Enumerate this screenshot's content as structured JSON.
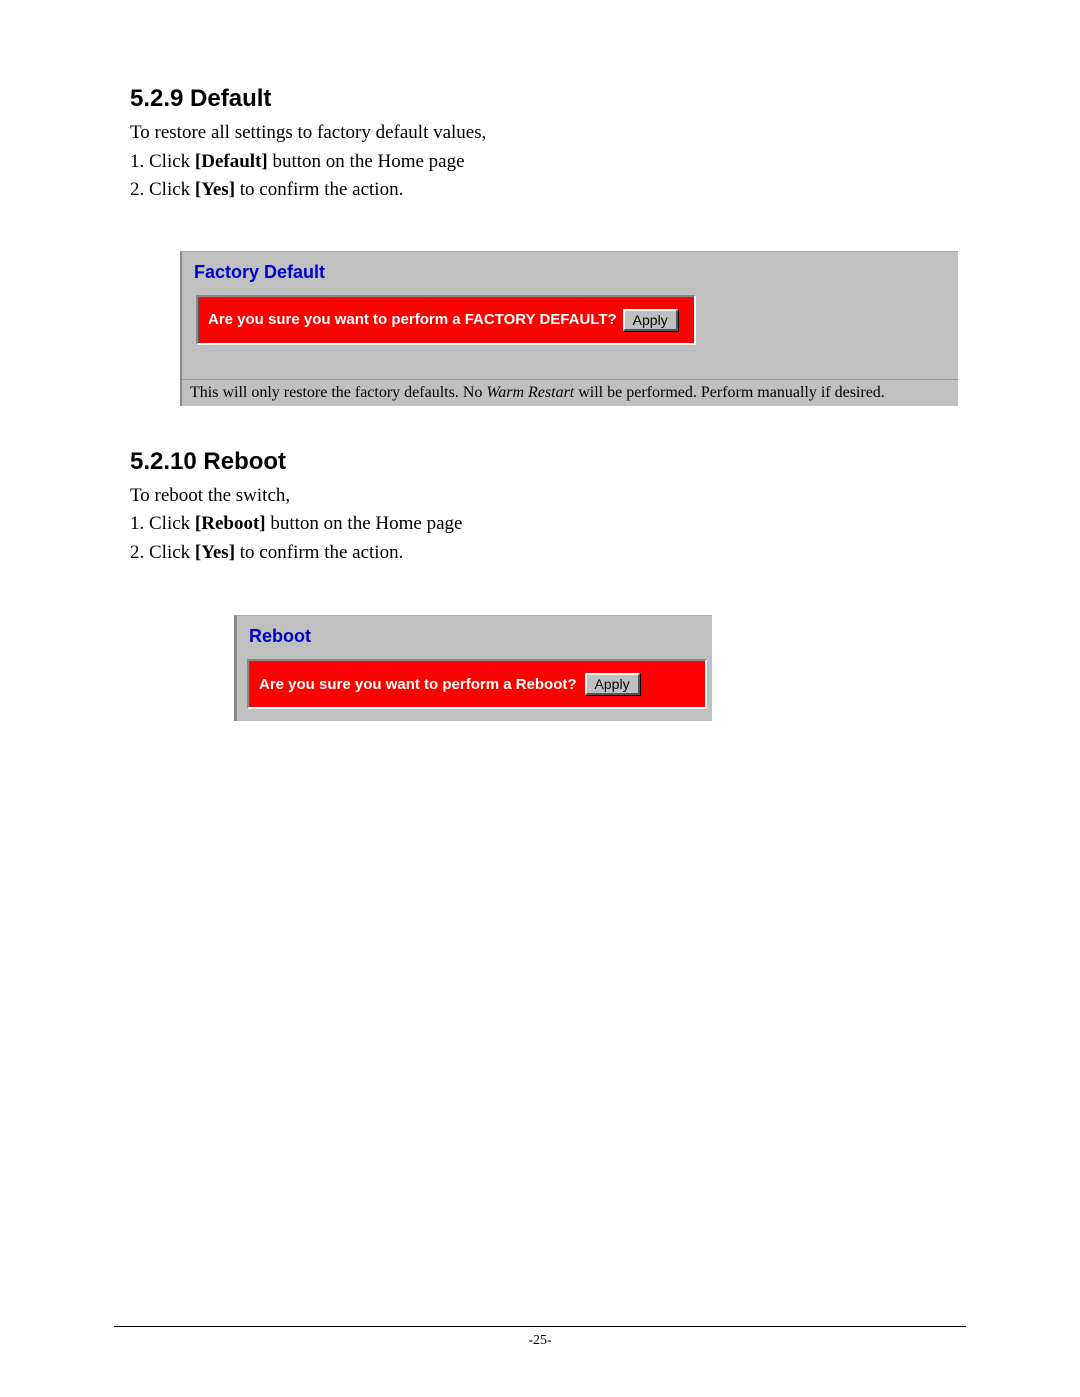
{
  "section1": {
    "heading": "5.2.9  Default",
    "intro": "To restore all settings to factory default values,",
    "step1_num": "1.  ",
    "step1_a": "Click ",
    "step1_bold": "[Default]",
    "step1_b": " button on the Home page",
    "step2_num": "2.  ",
    "step2_a": "Click ",
    "step2_bold": "[Yes]",
    "step2_b": " to confirm the action."
  },
  "panel1": {
    "title": "Factory Default",
    "question": "Are you sure you want to perform a FACTORY DEFAULT?",
    "button": "Apply",
    "note_a": "This will only restore the factory defaults.  No ",
    "note_italic": "Warm Restart",
    "note_b": " will be performed.  Perform manually if desired."
  },
  "section2": {
    "heading": "5.2.10  Reboot",
    "intro": "To reboot the switch,",
    "step1_num": "1.  ",
    "step1_a": "Click ",
    "step1_bold": "[Reboot]",
    "step1_b": " button on the Home page",
    "step2_num": "2.  ",
    "step2_a": "Click ",
    "step2_bold": "[Yes]",
    "step2_b": " to confirm the action."
  },
  "panel2": {
    "title": "Reboot",
    "question": "Are you sure you want to perform a Reboot?",
    "button": "Apply"
  },
  "footer": {
    "page": "-25-"
  }
}
